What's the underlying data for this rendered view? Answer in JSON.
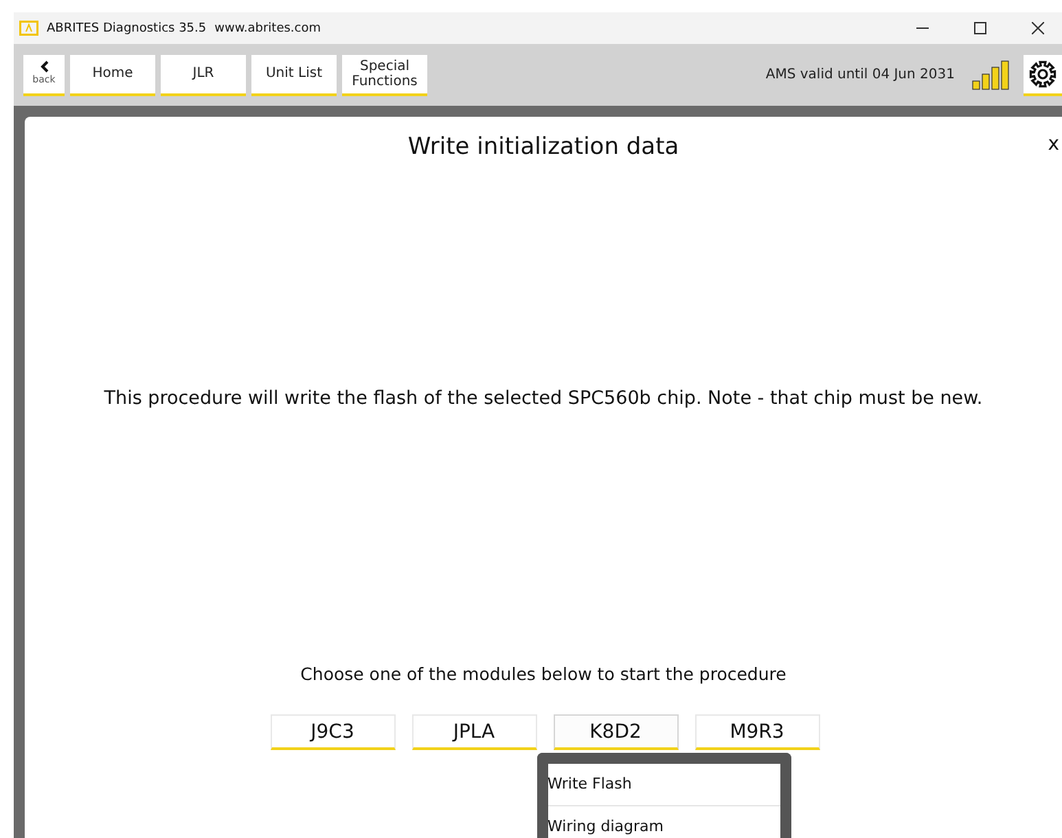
{
  "window": {
    "title": "ABRITES Diagnostics 35.5",
    "url": "www.abrites.com"
  },
  "toolbar": {
    "back_label": "back",
    "items": [
      {
        "label": "Home"
      },
      {
        "label": "JLR"
      },
      {
        "label": "Unit List"
      },
      {
        "label": "Special Functions"
      }
    ],
    "license": "AMS valid until 04 Jun 2031"
  },
  "dialog": {
    "title": "Write initialization data",
    "close": "x",
    "message": "This procedure will write the flash of the selected SPC560b chip. Note - that chip must be new.",
    "prompt": "Choose one of the modules below to start the procedure",
    "modules": [
      {
        "label": "J9C3",
        "expanded": false
      },
      {
        "label": "JPLA",
        "expanded": false
      },
      {
        "label": "K8D2",
        "expanded": true
      },
      {
        "label": "M9R3",
        "expanded": false
      }
    ],
    "module_menu": [
      "Write Flash",
      "Wiring diagram"
    ]
  }
}
